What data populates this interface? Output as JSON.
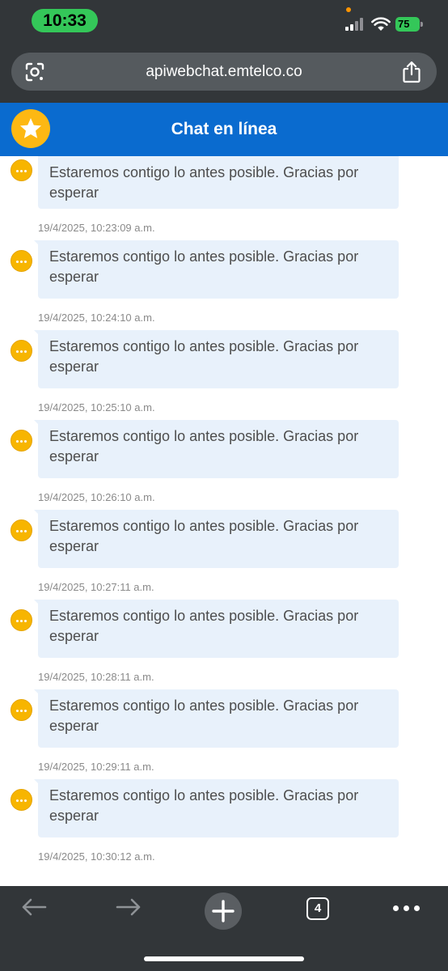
{
  "status_bar": {
    "time": "10:33",
    "battery": "75"
  },
  "browser": {
    "url": "apiwebchat.emtelco.co",
    "tab_count": "4"
  },
  "chat": {
    "title": "Chat en línea",
    "messages": [
      {
        "text": "Estaremos contigo lo antes posible. Gracias por esperar",
        "timestamp": "19/4/2025, 10:23:09 a.m."
      },
      {
        "text": "Estaremos contigo lo antes posible. Gracias por esperar",
        "timestamp": "19/4/2025, 10:24:10 a.m."
      },
      {
        "text": "Estaremos contigo lo antes posible. Gracias por esperar",
        "timestamp": "19/4/2025, 10:25:10 a.m."
      },
      {
        "text": "Estaremos contigo lo antes posible. Gracias por esperar",
        "timestamp": "19/4/2025, 10:26:10 a.m."
      },
      {
        "text": "Estaremos contigo lo antes posible. Gracias por esperar",
        "timestamp": "19/4/2025, 10:27:11 a.m."
      },
      {
        "text": "Estaremos contigo lo antes posible. Gracias por esperar",
        "timestamp": "19/4/2025, 10:28:11 a.m."
      },
      {
        "text": "Estaremos contigo lo antes posible. Gracias por esperar",
        "timestamp": "19/4/2025, 10:29:11 a.m."
      },
      {
        "text": "Estaremos contigo lo antes posible. Gracias por esperar",
        "timestamp": "19/4/2025, 10:30:12 a.m."
      }
    ]
  },
  "colors": {
    "header_blue": "#0a6bcf",
    "bubble_bg": "#e8f1fb",
    "avatar_yellow": "#f7b500",
    "time_pill_green": "#34c759"
  },
  "icons": {
    "url_bar_left": "google-lens-icon",
    "url_bar_right": "share-icon",
    "header": "star-icon",
    "avatar": "typing-dots-icon",
    "toolbar": [
      "back-arrow-icon",
      "forward-arrow-icon",
      "plus-icon",
      "tab-count-icon",
      "more-dots-icon"
    ]
  }
}
